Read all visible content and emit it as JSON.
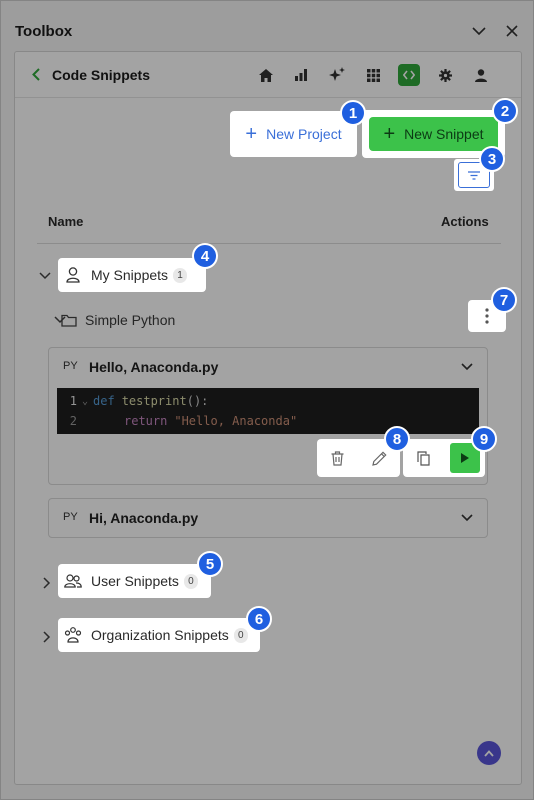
{
  "toolbox": {
    "title": "Toolbox"
  },
  "header": {
    "title": "Code Snippets"
  },
  "toolbar_icons": [
    "home-icon",
    "chart-icon",
    "sparkle-icon",
    "grid-icon",
    "code-icon",
    "gear-icon",
    "user-icon"
  ],
  "buttons": {
    "new_project": "New Project",
    "new_snippet": "New Snippet",
    "plus": "+"
  },
  "columns": {
    "name": "Name",
    "actions": "Actions"
  },
  "groups": {
    "my": {
      "label": "My Snippets",
      "count": "1"
    },
    "user": {
      "label": "User Snippets",
      "count": "0"
    },
    "org": {
      "label": "Organization Snippets",
      "count": "0"
    }
  },
  "folder": {
    "label": "Simple Python"
  },
  "snippets": [
    {
      "lang": "PY",
      "name": "Hello, Anaconda.py"
    },
    {
      "lang": "PY",
      "name": "Hi, Anaconda.py"
    }
  ],
  "code": {
    "line1": {
      "num": "1",
      "fold": "⌄",
      "kw": "def",
      "fn": "testprint",
      "punc": "():"
    },
    "line2": {
      "num": "2",
      "kw": "return",
      "str": "\"Hello, Anaconda\""
    }
  },
  "badges": [
    "1",
    "2",
    "3",
    "4",
    "5",
    "6",
    "7",
    "8",
    "9"
  ],
  "colors": {
    "accent_blue": "#3a6fd8",
    "green": "#3cc24a",
    "badge": "#1f5fe0",
    "scroll_top": "#5a55d9"
  }
}
